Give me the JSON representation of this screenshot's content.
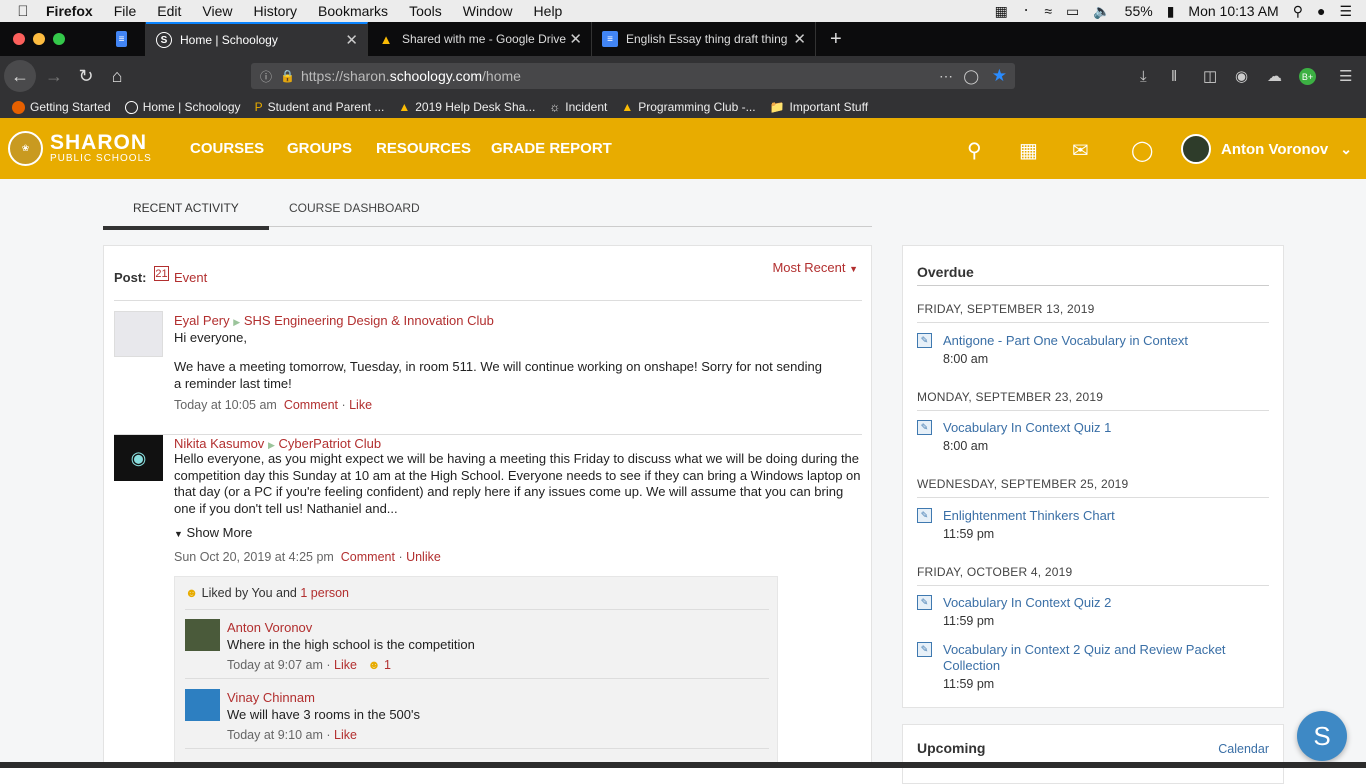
{
  "mac_menu": {
    "apple": "",
    "app": "Firefox",
    "items": [
      "File",
      "Edit",
      "View",
      "History",
      "Bookmarks",
      "Tools",
      "Window",
      "Help"
    ],
    "battery": "55%",
    "clock": "Mon 10:13 AM"
  },
  "tabs": [
    {
      "title": "",
      "favicon": "docs-icon"
    },
    {
      "title": "Home | Schoology",
      "favicon": "schoology-icon"
    },
    {
      "title": "Shared with me - Google Drive",
      "favicon": "drive-icon"
    },
    {
      "title": "English Essay thing draft thing",
      "favicon": "docs-icon"
    }
  ],
  "url": {
    "prefix": "https://sharon.",
    "domain": "schoology.com",
    "path": "/home"
  },
  "bookmarks": [
    "Getting Started",
    "Home | Schoology",
    "Student and Parent ...",
    "2019 Help Desk Sha...",
    "Incident",
    "Programming Club -...",
    "Important Stuff"
  ],
  "header": {
    "logo_line1": "SHARON",
    "logo_line2": "PUBLIC SCHOOLS",
    "nav": [
      "COURSES",
      "GROUPS",
      "RESOURCES",
      "GRADE REPORT"
    ],
    "user_name": "Anton Voronov"
  },
  "subtabs": {
    "recent": "RECENT ACTIVITY",
    "dashboard": "COURSE DASHBOARD"
  },
  "post_bar": {
    "label": "Post:",
    "event": "Event",
    "event_day": "21",
    "sort": "Most Recent"
  },
  "posts": [
    {
      "author": "Eyal Pery",
      "group": "SHS Engineering Design & Innovation Club",
      "line1": "Hi everyone,",
      "body": "We have a meeting tomorrow, Tuesday, in room 511. We will continue working on onshape! Sorry for not sending a reminder last time!",
      "time": "Today at 10:05 am",
      "comment": "Comment",
      "like": "Like"
    },
    {
      "author": "Nikita Kasumov",
      "group": "CyberPatriot Club",
      "body": "Hello everyone, as you might expect we will be having a meeting this Friday to discuss what we will be doing during the competition day this Sunday at 10 am at the High School. Everyone needs to see if they can bring a Windows laptop on that day (or a PC if you're feeling confident) and reply here if any issues come up. We will assume that you can bring one if you don't tell us! Nathaniel and...",
      "show_more": "Show More",
      "time": "Sun Oct 20, 2019 at 4:25 pm",
      "comment": "Comment",
      "unlike": "Unlike",
      "liked_by": "Liked by You and",
      "liked_count": "1 person"
    }
  ],
  "comments": [
    {
      "author": "Anton Voronov",
      "text": "Where in the high school is the competition",
      "time": "Today at 9:07 am",
      "like": "Like",
      "likes": "1"
    },
    {
      "author": "Vinay Chinnam",
      "text": "We will have 3 rooms in the 500's",
      "time": "Today at 9:10 am",
      "like": "Like"
    }
  ],
  "overdue": {
    "title": "Overdue",
    "days": [
      {
        "date": "FRIDAY, SEPTEMBER 13, 2019",
        "items": [
          {
            "name": "Antigone - Part One Vocabulary in Context",
            "time": "8:00 am"
          }
        ]
      },
      {
        "date": "MONDAY, SEPTEMBER 23, 2019",
        "items": [
          {
            "name": "Vocabulary In Context Quiz 1",
            "time": "8:00 am"
          }
        ]
      },
      {
        "date": "WEDNESDAY, SEPTEMBER 25, 2019",
        "items": [
          {
            "name": "Enlightenment Thinkers Chart",
            "time": "11:59 pm"
          }
        ]
      },
      {
        "date": "FRIDAY, OCTOBER 4, 2019",
        "items": [
          {
            "name": "Vocabulary In Context Quiz 2",
            "time": "11:59 pm"
          },
          {
            "name": "Vocabulary in Context 2 Quiz and Review Packet Collection",
            "time": "11:59 pm"
          }
        ]
      }
    ]
  },
  "upcoming": {
    "title": "Upcoming",
    "calendar": "Calendar"
  },
  "fab": "S",
  "colors": {
    "header": "#e8ac00",
    "link_red": "#b22f2f",
    "link_blue": "#3a6fa6"
  }
}
